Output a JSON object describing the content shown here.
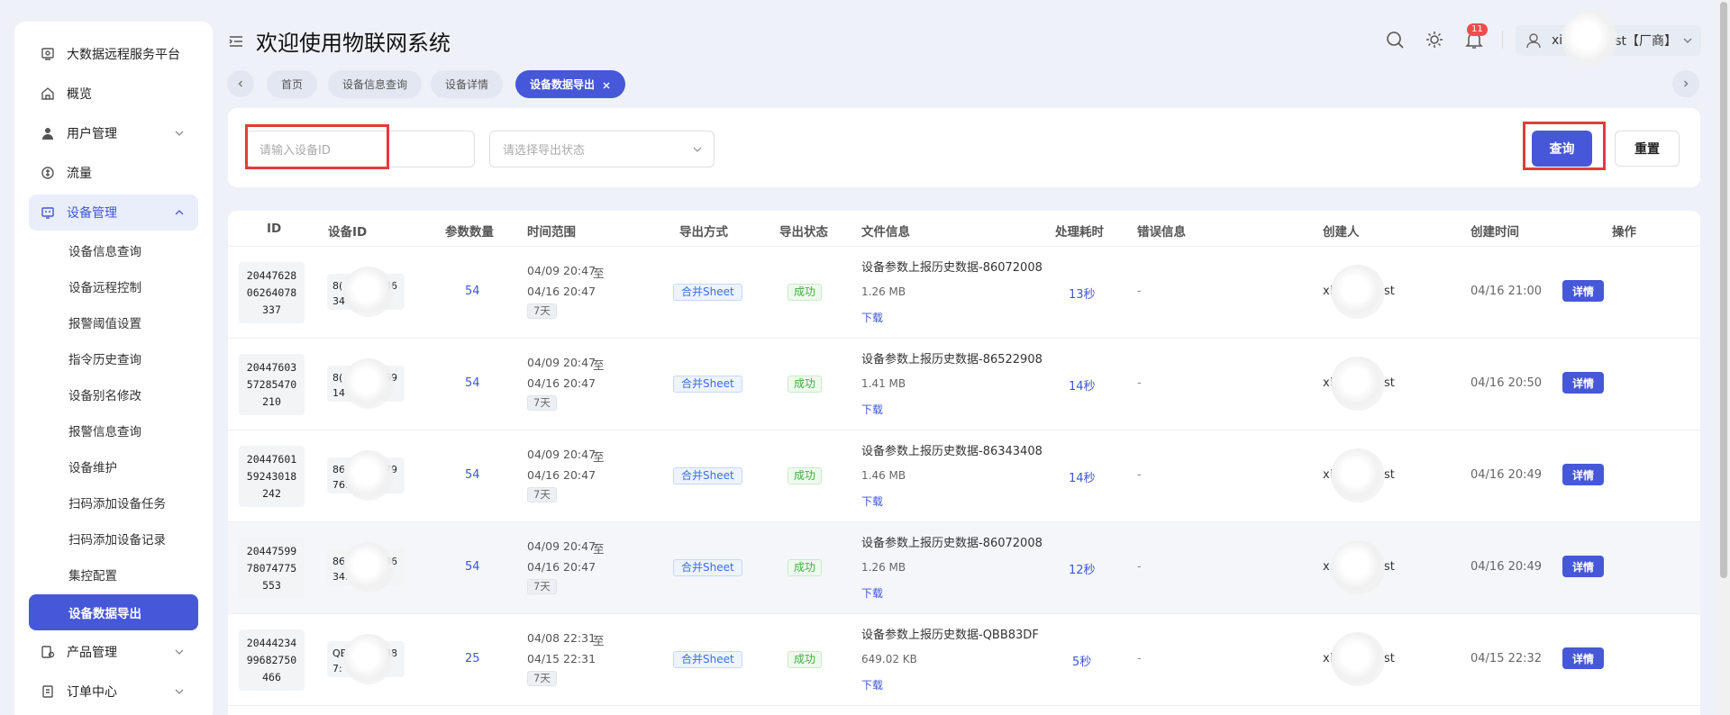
{
  "sidebar": {
    "items": [
      {
        "label": "大数据远程服务平台",
        "icon": "screen-icon"
      },
      {
        "label": "概览",
        "icon": "home-icon"
      },
      {
        "label": "用户管理",
        "icon": "user-icon",
        "expandable": true
      },
      {
        "label": "流量",
        "icon": "traffic-icon"
      },
      {
        "label": "设备管理",
        "icon": "device-icon",
        "expandable": true,
        "expanded": true
      }
    ],
    "subitems": [
      {
        "label": "设备信息查询"
      },
      {
        "label": "设备远程控制"
      },
      {
        "label": "报警阈值设置"
      },
      {
        "label": "指令历史查询"
      },
      {
        "label": "设备别名修改"
      },
      {
        "label": "报警信息查询"
      },
      {
        "label": "设备维护"
      },
      {
        "label": "扫码添加设备任务"
      },
      {
        "label": "扫码添加设备记录"
      },
      {
        "label": "集控配置"
      },
      {
        "label": "设备数据导出",
        "active": true
      }
    ],
    "bottom_items": [
      {
        "label": "产品管理",
        "icon": "product-icon",
        "expandable": true
      },
      {
        "label": "订单中心",
        "icon": "order-icon",
        "expandable": true
      }
    ]
  },
  "header": {
    "title": "欢迎使用物联网系统",
    "notification_count": "11",
    "user_prefix": "xi",
    "user_suffix": "st【厂商】"
  },
  "tabs": [
    {
      "label": "首页"
    },
    {
      "label": "设备信息查询"
    },
    {
      "label": "设备详情"
    },
    {
      "label": "设备数据导出",
      "active": true
    }
  ],
  "search": {
    "device_id_placeholder": "请输入设备ID",
    "status_placeholder": "请选择导出状态",
    "query_label": "查询",
    "reset_label": "重置"
  },
  "table": {
    "columns": [
      "ID",
      "设备ID",
      "参数数量",
      "时间范围",
      "导出方式",
      "导出状态",
      "文件信息",
      "处理耗时",
      "错误信息",
      "创建人",
      "创建时间",
      "操作"
    ],
    "download_label": "下载",
    "detail_label": "详情",
    "range_sep": "至",
    "rows": [
      {
        "id_lines": [
          "20447628",
          "06264078",
          "337"
        ],
        "dev_l1": "8(",
        "dev_r1": "36",
        "dev_l2": "34",
        "params": "54",
        "start": "04/09 20:47",
        "end": "04/16 20:47",
        "days": "7天",
        "method": "合并Sheet",
        "status": "成功",
        "file_name": "设备参数上报历史数据-86072008",
        "file_size": "1.26 MB",
        "duration": "13秒",
        "error": "-",
        "creator_l": "xi",
        "creator_r": "st",
        "created": "04/16 21:00"
      },
      {
        "id_lines": [
          "20447603",
          "57285470",
          "210"
        ],
        "dev_l1": "8(",
        "dev_r1": "69",
        "dev_l2": "14",
        "params": "54",
        "start": "04/09 20:47",
        "end": "04/16 20:47",
        "days": "7天",
        "method": "合并Sheet",
        "status": "成功",
        "file_name": "设备参数上报历史数据-86522908",
        "file_size": "1.41 MB",
        "duration": "14秒",
        "error": "-",
        "creator_l": "xi",
        "creator_r": "st",
        "created": "04/16 20:50"
      },
      {
        "id_lines": [
          "20447601",
          "59243018",
          "242"
        ],
        "dev_l1": "86",
        "dev_r1": "79",
        "dev_l2": "76.",
        "params": "54",
        "start": "04/09 20:47",
        "end": "04/16 20:47",
        "days": "7天",
        "method": "合并Sheet",
        "status": "成功",
        "file_name": "设备参数上报历史数据-86343408",
        "file_size": "1.46 MB",
        "duration": "14秒",
        "error": "-",
        "creator_l": "xi",
        "creator_r": "st",
        "created": "04/16 20:49"
      },
      {
        "id_lines": [
          "20447599",
          "78074775",
          "553"
        ],
        "dev_l1": "86(",
        "dev_r1": "36",
        "dev_l2": "34.",
        "params": "54",
        "start": "04/09 20:47",
        "end": "04/16 20:47",
        "days": "7天",
        "method": "合并Sheet",
        "status": "成功",
        "file_name": "设备参数上报历史数据-86072008",
        "file_size": "1.26 MB",
        "duration": "12秒",
        "error": "-",
        "creator_l": "x.",
        "creator_r": "st",
        "created": "04/16 20:49"
      },
      {
        "id_lines": [
          "20444234",
          "99682750",
          "466"
        ],
        "dev_l1": "QB",
        "dev_r1": "38",
        "dev_l2": "7:",
        "params": "25",
        "start": "04/08 22:31",
        "end": "04/15 22:31",
        "days": "7天",
        "method": "合并Sheet",
        "status": "成功",
        "file_name": "设备参数上报历史数据-QBB83DF",
        "file_size": "649.02 KB",
        "duration": "5秒",
        "error": "-",
        "creator_l": "xi",
        "creator_r": "st",
        "created": "04/15 22:32"
      }
    ]
  }
}
